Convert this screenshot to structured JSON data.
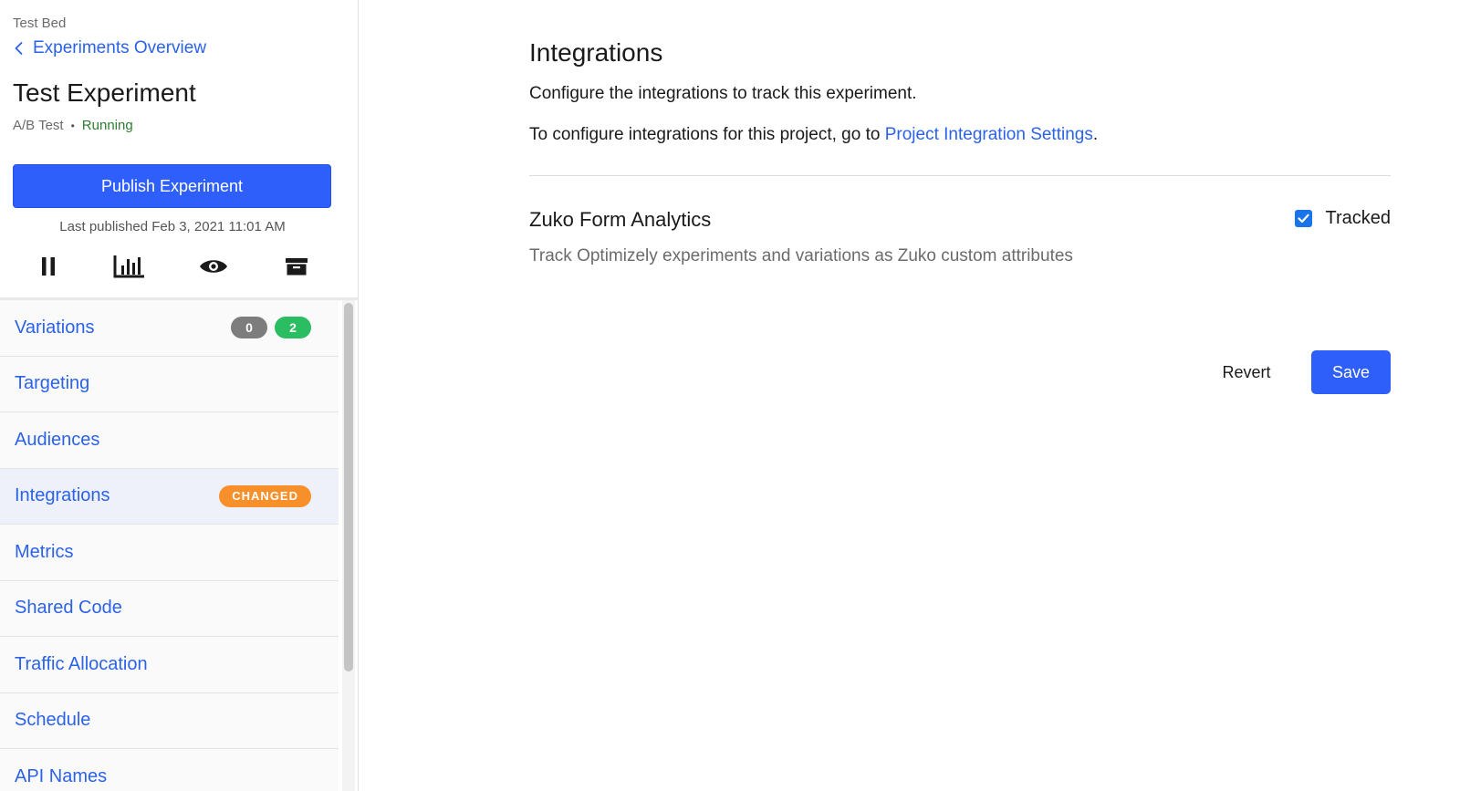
{
  "sidebar": {
    "project_name": "Test Bed",
    "back_link": "Experiments Overview",
    "experiment_title": "Test Experiment",
    "experiment_type": "A/B Test",
    "status": "Running",
    "publish_button": "Publish Experiment",
    "last_published": "Last published Feb 3, 2021 11:01 AM",
    "actions": [
      {
        "icon": "pause-icon"
      },
      {
        "icon": "results-chart-icon"
      },
      {
        "icon": "preview-eye-icon"
      },
      {
        "icon": "archive-icon"
      }
    ],
    "nav": [
      {
        "label": "Variations",
        "badges": [
          "0",
          "2"
        ]
      },
      {
        "label": "Targeting"
      },
      {
        "label": "Audiences"
      },
      {
        "label": "Integrations",
        "badge": "CHANGED",
        "active": true
      },
      {
        "label": "Metrics"
      },
      {
        "label": "Shared Code"
      },
      {
        "label": "Traffic Allocation"
      },
      {
        "label": "Schedule"
      },
      {
        "label": "API Names"
      }
    ]
  },
  "main": {
    "title": "Integrations",
    "description": "Configure the integrations to track this experiment.",
    "config_prefix": "To configure integrations for this project, go to ",
    "config_link": "Project Integration Settings",
    "config_suffix": ".",
    "integration": {
      "name": "Zuko Form Analytics",
      "description": "Track Optimizely experiments and variations as Zuko custom attributes",
      "tracked_label": "Tracked",
      "tracked": true
    },
    "revert_label": "Revert",
    "save_label": "Save"
  },
  "colors": {
    "primary": "#2f5ffb",
    "link": "#2b62ea",
    "running": "#2e7d32",
    "badge_gray": "#7d7d7d",
    "badge_green": "#2bbd62",
    "badge_changed": "#f7902b"
  }
}
